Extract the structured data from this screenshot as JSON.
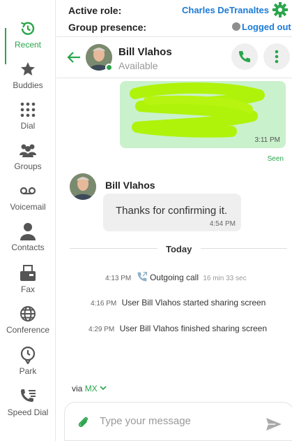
{
  "sidebar": {
    "items": [
      {
        "label": "Recent",
        "icon": "recent-icon",
        "active": true
      },
      {
        "label": "Buddies",
        "icon": "star-icon"
      },
      {
        "label": "Dial",
        "icon": "dialpad-icon"
      },
      {
        "label": "Groups",
        "icon": "groups-icon"
      },
      {
        "label": "Voicemail",
        "icon": "voicemail-icon"
      },
      {
        "label": "Contacts",
        "icon": "contact-icon"
      },
      {
        "label": "Fax",
        "icon": "fax-icon"
      },
      {
        "label": "Conference",
        "icon": "globe-icon"
      },
      {
        "label": "Park",
        "icon": "park-icon"
      },
      {
        "label": "Speed Dial",
        "icon": "speed-dial-icon"
      }
    ]
  },
  "status": {
    "active_role_label": "Active role:",
    "active_role_value": "Charles DeTranaltes",
    "group_presence_label": "Group presence:",
    "group_presence_value": "Logged out"
  },
  "chat": {
    "contact_name": "Bill Vlahos",
    "contact_status": "Available",
    "messages": {
      "sent_time": "3:11 PM",
      "seen_label": "Seen",
      "sender_name": "Bill Vlahos",
      "received_text": "Thanks for confirming it.",
      "received_time": "4:54 PM"
    },
    "day_separator": "Today",
    "events": [
      {
        "time": "4:13 PM",
        "text": "Outgoing call",
        "duration": "16 min 33 sec"
      },
      {
        "time": "4:16 PM",
        "text": "User Bill Vlahos started sharing screen"
      },
      {
        "time": "4:29 PM",
        "text": "User Bill Vlahos finished sharing screen"
      }
    ]
  },
  "composer": {
    "via_label": "via",
    "carrier": "MX",
    "placeholder": "Type your message"
  },
  "colors": {
    "accent_green": "#2aa54b",
    "link_blue": "#1b7bd6",
    "sent_bubble": "#c9f1cc",
    "received_bubble": "#efefef"
  }
}
